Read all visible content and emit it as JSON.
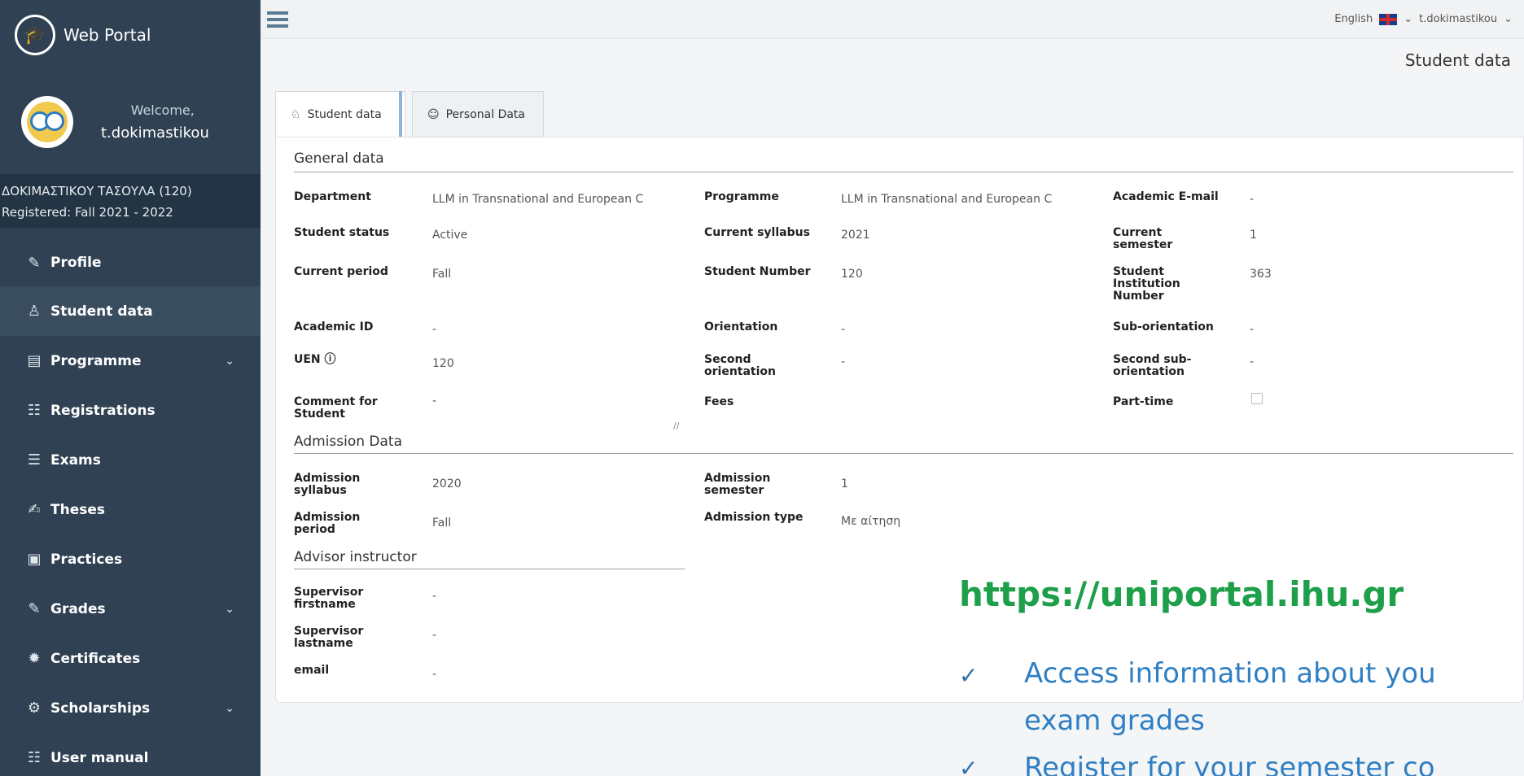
{
  "brand": {
    "title": "Web Portal"
  },
  "user": {
    "welcome": "Welcome,",
    "username": "t.dokimastikou"
  },
  "student_banner": {
    "name": "ΔΟΚΙΜΑΣΤΙΚΟΥ ΤΑΣΟΥΛΑ (120)",
    "registered": "Registered: Fall 2021 - 2022"
  },
  "menu": [
    {
      "label": "Profile",
      "icon": "profile-icon"
    },
    {
      "label": "Student data",
      "icon": "student-icon"
    },
    {
      "label": "Programme",
      "icon": "programme-icon"
    },
    {
      "label": "Registrations",
      "icon": "registrations-icon"
    },
    {
      "label": "Exams",
      "icon": "exams-icon"
    },
    {
      "label": "Theses",
      "icon": "theses-icon"
    },
    {
      "label": "Practices",
      "icon": "practices-icon"
    },
    {
      "label": "Grades",
      "icon": "grades-icon"
    },
    {
      "label": "Certificates",
      "icon": "certificates-icon"
    },
    {
      "label": "Scholarships",
      "icon": "scholarships-icon"
    },
    {
      "label": "User manual",
      "icon": "manual-icon"
    }
  ],
  "topbar": {
    "language": "English",
    "user": "t.dokimastikou"
  },
  "page_title": "Student data",
  "tabs": [
    {
      "label": "Student data"
    },
    {
      "label": "Personal Data"
    }
  ],
  "general": {
    "title": "General data",
    "department_label": "Department",
    "department_value": "LLM in Transnational and European C",
    "programme_label": "Programme",
    "programme_value": "LLM in Transnational and European C",
    "email_label": "Academic E-mail",
    "email_value": "-",
    "status_label": "Student status",
    "status_value": "Active",
    "syllabus_label": "Current syllabus",
    "syllabus_value": "2021",
    "semester_label_1": "Current",
    "semester_label_2": "semester",
    "semester_value": "1",
    "period_label": "Current period",
    "period_value": "Fall",
    "number_label": "Student Number",
    "number_value": "120",
    "inst_label_1": "Student",
    "inst_label_2": "Institution",
    "inst_label_3": "Number",
    "inst_value": "363",
    "acad_id_label": "Academic ID",
    "acad_id_value": "-",
    "orientation_label": "Orientation",
    "orientation_value": "-",
    "suborientation_label": "Sub-orientation",
    "suborientation_value": "-",
    "uen_label": "UEN",
    "uen_value": "120",
    "second_or_label_1": "Second",
    "second_or_label_2": "orientation",
    "second_or_value": "-",
    "second_sub_label_1": "Second sub-",
    "second_sub_label_2": "orientation",
    "second_sub_value": "-",
    "comment_label_1": "Comment for",
    "comment_label_2": "Student",
    "comment_value": "-",
    "fees_label": "Fees",
    "parttime_label": "Part-time"
  },
  "admission": {
    "title": "Admission Data",
    "syllabus_label_1": "Admission",
    "syllabus_label_2": "syllabus",
    "syllabus_value": "2020",
    "semester_label_1": "Admission",
    "semester_label_2": "semester",
    "semester_value": "1",
    "period_label_1": "Admission",
    "period_label_2": "period",
    "period_value": "Fall",
    "type_label": "Admission type",
    "type_value": "Με αίτηση"
  },
  "advisor": {
    "title": "Advisor instructor",
    "first_label_1": "Supervisor",
    "first_label_2": "firstname",
    "first_value": "-",
    "last_label_1": "Supervisor",
    "last_label_2": "lastname",
    "last_value": "-",
    "email_label": "email",
    "email_value": "-"
  },
  "promo": {
    "url": "https://uniportal.ihu.gr",
    "line1": "Access information about you",
    "line2": "exam grades",
    "line3": "Register for your semester co"
  },
  "colors": {
    "sidebar": "#2f4152",
    "promo_url": "#1e9f4a",
    "promo_text": "#2f7fc4"
  }
}
